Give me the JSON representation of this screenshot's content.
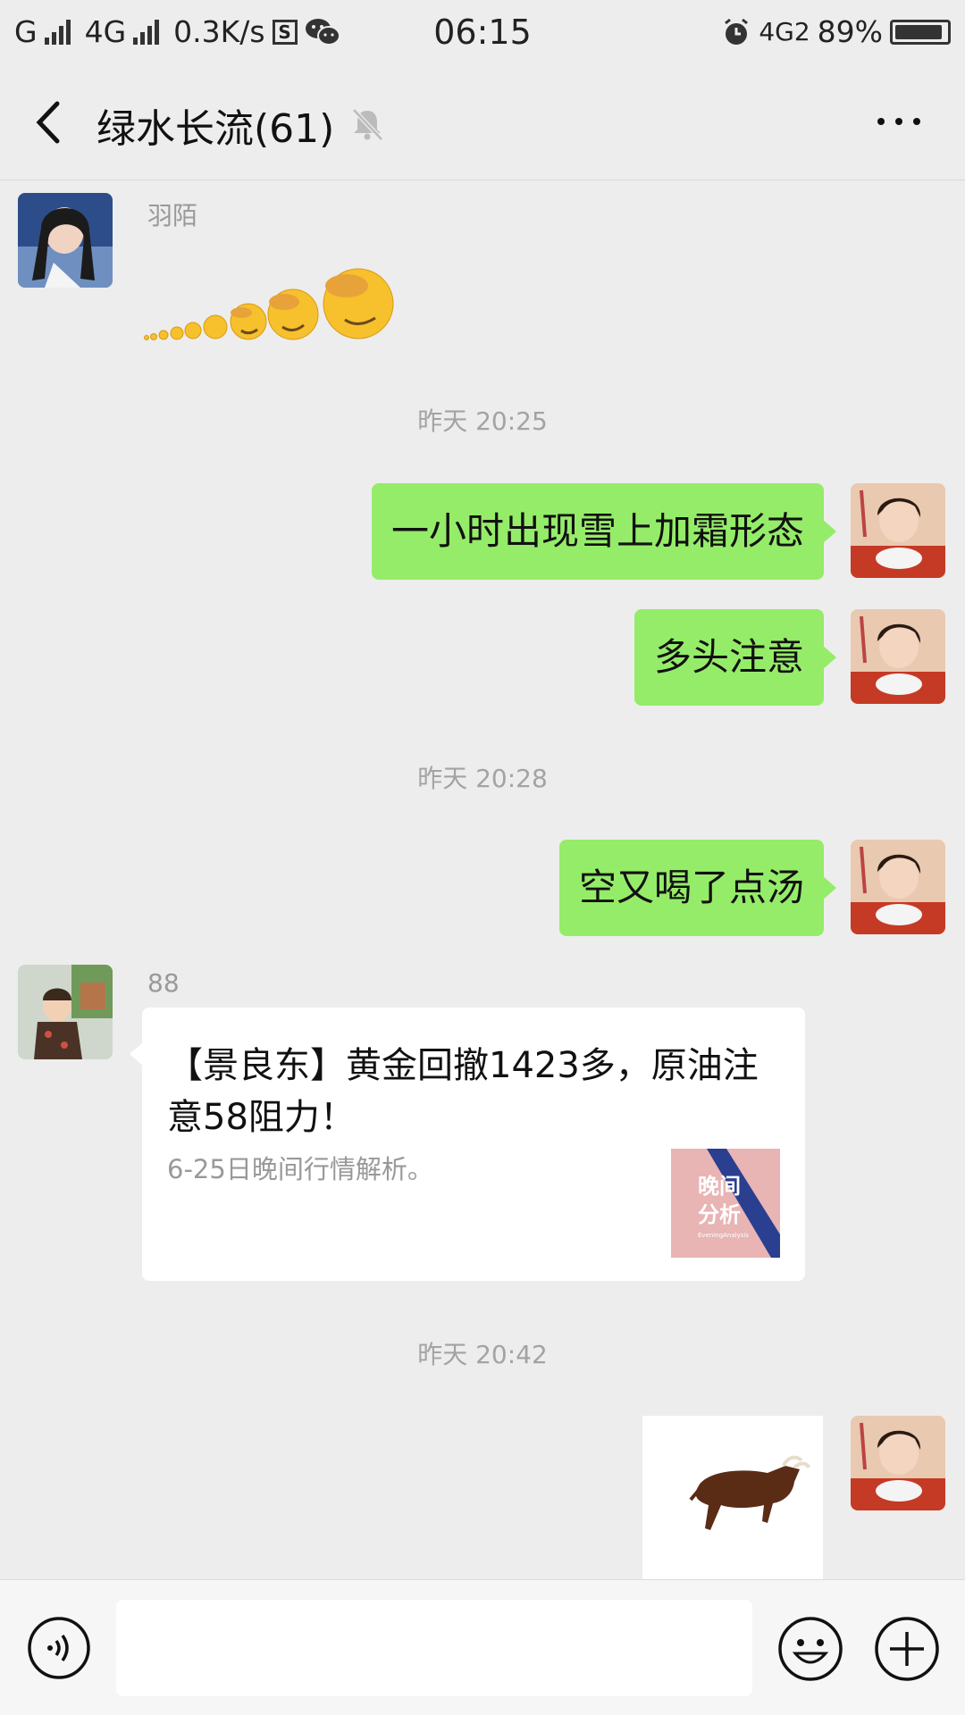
{
  "status_bar": {
    "carrier1": "G",
    "carrier2": "4G",
    "speed": "0.3K/s",
    "s_icon": "S",
    "time": "06:15",
    "network_right": "4G2",
    "battery": "89%",
    "icons": [
      "signal-icon",
      "wechat-icon",
      "alarm-icon",
      "battery-icon"
    ]
  },
  "nav": {
    "title": "绿水长流(61)",
    "icons": [
      "back-chevron-icon",
      "mute-bell-icon",
      "more-dots-icon"
    ]
  },
  "messages": {
    "m1": {
      "sender": "羽陌",
      "type": "emoji-sticker",
      "sticker": "facepalm-emoji-sequence"
    },
    "ts1": "昨天 20:25",
    "m2": {
      "text": "一小时出现雪上加霜形态",
      "outgoing": true
    },
    "m3": {
      "text": "多头注意",
      "outgoing": true
    },
    "ts2": "昨天 20:28",
    "m4": {
      "text": "空又喝了点汤",
      "outgoing": true
    },
    "m5": {
      "sender": "88",
      "type": "link-card",
      "title": "【景良东】黄金回撤1423多，原油注意58阻力！",
      "desc": "6-25日晚间行情解析。",
      "thumb_text": "晚间\n分析",
      "thumb_sub": "EveningAnalysis"
    },
    "ts3": "昨天 20:42",
    "m6": {
      "type": "image",
      "image": "bull-sticker",
      "outgoing": true
    }
  },
  "input_bar": {
    "value": "",
    "icons": [
      "voice-icon",
      "emoji-icon",
      "plus-icon"
    ]
  },
  "colors": {
    "outgoing_bubble": "#95ec69",
    "background": "#ededed",
    "incoming_bubble": "#ffffff"
  }
}
